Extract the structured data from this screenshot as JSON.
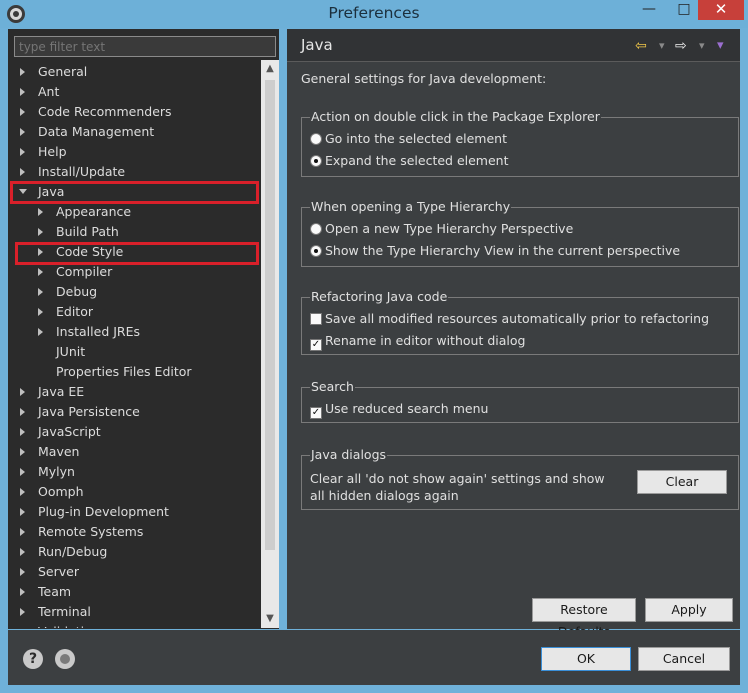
{
  "window": {
    "title": "Preferences",
    "minimize": "—",
    "maximize": "□",
    "close": "✕"
  },
  "filter": {
    "placeholder": "type filter text"
  },
  "tree": {
    "items": [
      {
        "label": "General",
        "expanded": false
      },
      {
        "label": "Ant",
        "expanded": false
      },
      {
        "label": "Code Recommenders",
        "expanded": false
      },
      {
        "label": "Data Management",
        "expanded": false
      },
      {
        "label": "Help",
        "expanded": false
      },
      {
        "label": "Install/Update",
        "expanded": false
      },
      {
        "label": "Java",
        "expanded": true
      },
      {
        "label": "Appearance",
        "expanded": false
      },
      {
        "label": "Build Path",
        "expanded": false
      },
      {
        "label": "Code Style",
        "expanded": false
      },
      {
        "label": "Compiler",
        "expanded": false
      },
      {
        "label": "Debug",
        "expanded": false
      },
      {
        "label": "Editor",
        "expanded": false
      },
      {
        "label": "Installed JREs",
        "expanded": false
      },
      {
        "label": "JUnit"
      },
      {
        "label": "Properties Files Editor"
      },
      {
        "label": "Java EE",
        "expanded": false
      },
      {
        "label": "Java Persistence",
        "expanded": false
      },
      {
        "label": "JavaScript",
        "expanded": false
      },
      {
        "label": "Maven",
        "expanded": false
      },
      {
        "label": "Mylyn",
        "expanded": false
      },
      {
        "label": "Oomph",
        "expanded": false
      },
      {
        "label": "Plug-in Development",
        "expanded": false
      },
      {
        "label": "Remote Systems",
        "expanded": false
      },
      {
        "label": "Run/Debug",
        "expanded": false
      },
      {
        "label": "Server",
        "expanded": false
      },
      {
        "label": "Team",
        "expanded": false
      },
      {
        "label": "Terminal",
        "expanded": false
      },
      {
        "label": "Validation",
        "expanded": false
      }
    ]
  },
  "page": {
    "title": "Java",
    "description": "General settings for Java development:",
    "nav": {
      "back": "⇦",
      "forward": "⇨",
      "menu": "▾"
    },
    "double_click": {
      "title": "Action on double click in the Package Explorer",
      "option1": "Go into the selected element",
      "option2": "Expand the selected element",
      "selected": "option2"
    },
    "type_hierarchy": {
      "title": "When opening a Type Hierarchy",
      "option1": "Open a new Type Hierarchy Perspective",
      "option2": "Show the Type Hierarchy View in the current perspective",
      "selected": "option2"
    },
    "refactoring": {
      "title": "Refactoring Java code",
      "option1": "Save all modified resources automatically prior to refactoring",
      "option1_checked": false,
      "option2": "Rename in editor without dialog",
      "option2_checked": true
    },
    "search": {
      "title": "Search",
      "option1": "Use reduced search menu",
      "option1_checked": true
    },
    "dialogs": {
      "title": "Java dialogs",
      "text": "Clear all 'do not show again' settings and show all hidden dialogs again",
      "clear_label": "Clear"
    },
    "restore_defaults_label": "Restore Defaults",
    "apply_label": "Apply"
  },
  "footer": {
    "ok_label": "OK",
    "cancel_label": "Cancel",
    "help": "?"
  },
  "colors": {
    "titlebar": "#6db0d8",
    "highlight": "#d9202a",
    "dark_bg": "#2b2b2b",
    "panel_bg": "#3c3f41"
  }
}
